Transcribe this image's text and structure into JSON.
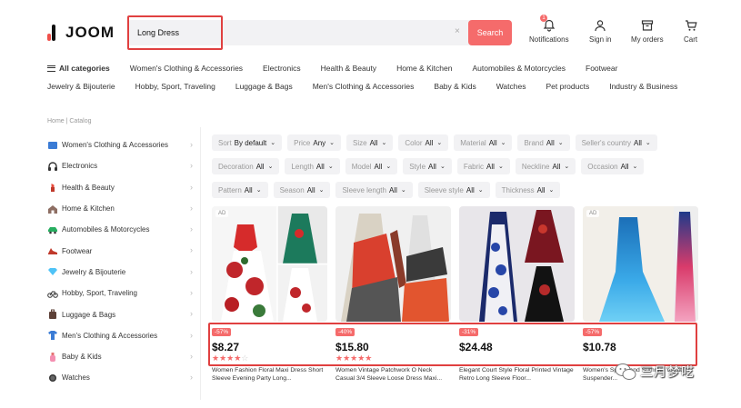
{
  "header": {
    "logo": "JOOM",
    "search": {
      "value": "Long Dress",
      "button": "Search",
      "clear": "×"
    },
    "notifications": {
      "label": "Notifications",
      "count": "1"
    },
    "signin": "Sign in",
    "orders": "My orders",
    "cart": "Cart"
  },
  "categories_row1": [
    "All categories",
    "Women's Clothing & Accessories",
    "Electronics",
    "Health & Beauty",
    "Home & Kitchen",
    "Automobiles & Motorcycles",
    "Footwear"
  ],
  "categories_row2": [
    "Jewelry & Bijouterie",
    "Hobby, Sport, Traveling",
    "Luggage & Bags",
    "Men's Clothing & Accessories",
    "Baby & Kids",
    "Watches",
    "Pet products",
    "Industry & Business"
  ],
  "breadcrumb": "Home | Catalog",
  "sidebar": [
    {
      "label": "Women's Clothing & Accessories",
      "icon": "dress-icon"
    },
    {
      "label": "Electronics",
      "icon": "headphones-icon"
    },
    {
      "label": "Health & Beauty",
      "icon": "lipstick-icon"
    },
    {
      "label": "Home & Kitchen",
      "icon": "house-icon"
    },
    {
      "label": "Automobiles & Motorcycles",
      "icon": "car-icon"
    },
    {
      "label": "Footwear",
      "icon": "shoe-icon"
    },
    {
      "label": "Jewelry & Bijouterie",
      "icon": "diamond-icon"
    },
    {
      "label": "Hobby, Sport, Traveling",
      "icon": "bicycle-icon"
    },
    {
      "label": "Luggage & Bags",
      "icon": "luggage-icon"
    },
    {
      "label": "Men's Clothing & Accessories",
      "icon": "shirt-icon"
    },
    {
      "label": "Baby & Kids",
      "icon": "baby-icon"
    },
    {
      "label": "Watches",
      "icon": "watch-icon"
    }
  ],
  "filters": [
    [
      {
        "label": "Sort",
        "value": "By default"
      },
      {
        "label": "Price",
        "value": "Any"
      },
      {
        "label": "Size",
        "value": "All"
      },
      {
        "label": "Color",
        "value": "All"
      },
      {
        "label": "Material",
        "value": "All"
      },
      {
        "label": "Brand",
        "value": "All"
      },
      {
        "label": "Seller's country",
        "value": "All"
      }
    ],
    [
      {
        "label": "Decoration",
        "value": "All"
      },
      {
        "label": "Length",
        "value": "All"
      },
      {
        "label": "Model",
        "value": "All"
      },
      {
        "label": "Style",
        "value": "All"
      },
      {
        "label": "Fabric",
        "value": "All"
      },
      {
        "label": "Neckline",
        "value": "All"
      },
      {
        "label": "Occasion",
        "value": "All"
      }
    ],
    [
      {
        "label": "Pattern",
        "value": "All"
      },
      {
        "label": "Season",
        "value": "All"
      },
      {
        "label": "Sleeve length",
        "value": "All"
      },
      {
        "label": "Sleeve style",
        "value": "All"
      },
      {
        "label": "Thickness",
        "value": "All"
      }
    ]
  ],
  "products": [
    {
      "ad": "AD",
      "discount": "-57%",
      "price": "$8.27",
      "rating": 4,
      "name": "Women Fashion Floral Maxi Dress Short Sleeve Evening Party Long..."
    },
    {
      "ad": "",
      "discount": "-40%",
      "price": "$15.80",
      "rating": 5,
      "name": "Women Vintage Patchwork O Neck Casual 3/4 Sleeve Loose Dress Maxi..."
    },
    {
      "ad": "",
      "discount": "-31%",
      "price": "$24.48",
      "rating": 0,
      "name": "Elegant Court Style Floral Printed Vintage Retro Long Sleeve Floor..."
    },
    {
      "ad": "AD",
      "discount": "-57%",
      "price": "$10.78",
      "rating": 0,
      "name": "Women's Spring and Summer Waist Suspender..."
    }
  ],
  "watermark": "三月梦呓",
  "colors": {
    "accent": "#f56b6b",
    "highlight": "#e04040"
  }
}
